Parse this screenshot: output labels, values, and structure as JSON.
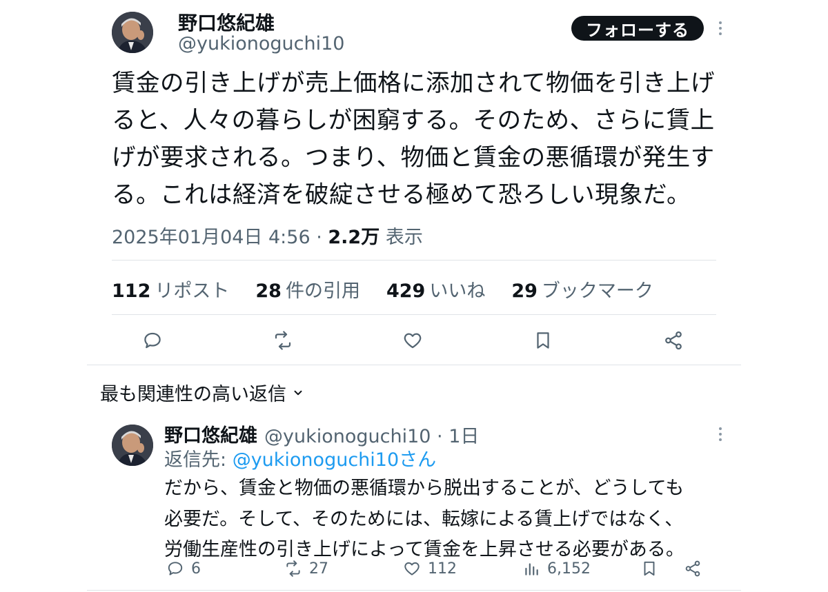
{
  "tweet": {
    "author_name": "野口悠紀雄",
    "author_handle": "@yukionoguchi10",
    "follow_label": "フォローする",
    "text_lines": [
      "賃金の引き上げが売上価格に添加されて物価を引き上げ",
      "ると、人々の暮らしが困窮する。そのため、さらに賃上",
      "げが要求される。つまり、物価と賃金の悪循環が発生す",
      "る。これは経済を破綻させる極めて恐ろしい現象だ。"
    ],
    "timestamp": "2025年01月04日 4:56",
    "separator": " · ",
    "views_count": "2.2万",
    "views_label": "表示",
    "stats": {
      "reposts_count": "112",
      "reposts_label": "リポスト",
      "quotes_count": "28",
      "quotes_label": "件の引用",
      "likes_count": "429",
      "likes_label": "いいね",
      "bookmarks_count": "29",
      "bookmarks_label": "ブックマーク"
    },
    "icons": [
      "reply-icon",
      "repost-icon",
      "like-icon",
      "bookmark-icon",
      "share-icon"
    ]
  },
  "replies_sort": {
    "label": "最も関連性の高い返信"
  },
  "reply": {
    "author_name": "野口悠紀雄",
    "author_handle": "@yukionoguchi10",
    "separator": " · ",
    "time_ago": "1日",
    "reply_to_label": "返信先: ",
    "reply_to_handle": "@yukionoguchi10さん",
    "text_lines": [
      "だから、賃金と物価の悪循環から脱出することが、どうしても",
      "必要だ。そして、そのためには、転嫁による賃上げではなく、",
      "労働生産性の引き上げによって賃金を上昇させる必要がある。"
    ],
    "reply_count": "6",
    "repost_count": "27",
    "like_count": "112",
    "view_count": "6,152"
  },
  "colors": {
    "text_primary": "#0f1419",
    "text_secondary": "#536471",
    "link": "#1d9bf0",
    "divider": "#dfe3e7",
    "button_bg": "#0f1419"
  }
}
